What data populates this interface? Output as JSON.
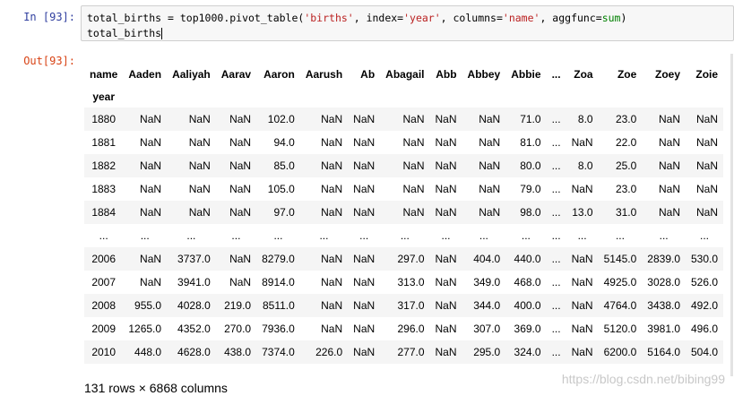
{
  "prompts": {
    "in": "In  [93]:",
    "out": "Out[93]:"
  },
  "code": {
    "line1_parts": [
      "total_births = top1000.pivot_table(",
      "'births'",
      ", index=",
      "'year'",
      ", columns=",
      "'name'",
      ", aggfunc=",
      "sum",
      ")"
    ],
    "line2": "total_births"
  },
  "table": {
    "column_header_label": "name",
    "columns": [
      "Aaden",
      "Aaliyah",
      "Aarav",
      "Aaron",
      "Aarush",
      "Ab",
      "Abagail",
      "Abb",
      "Abbey",
      "Abbie",
      "...",
      "Zoa",
      "Zoe",
      "Zoey",
      "Zoie"
    ],
    "index_label": "year",
    "rows": [
      {
        "year": "1880",
        "values": [
          "NaN",
          "NaN",
          "NaN",
          "102.0",
          "NaN",
          "NaN",
          "NaN",
          "NaN",
          "NaN",
          "71.0",
          "...",
          "8.0",
          "23.0",
          "NaN",
          "NaN"
        ]
      },
      {
        "year": "1881",
        "values": [
          "NaN",
          "NaN",
          "NaN",
          "94.0",
          "NaN",
          "NaN",
          "NaN",
          "NaN",
          "NaN",
          "81.0",
          "...",
          "NaN",
          "22.0",
          "NaN",
          "NaN"
        ]
      },
      {
        "year": "1882",
        "values": [
          "NaN",
          "NaN",
          "NaN",
          "85.0",
          "NaN",
          "NaN",
          "NaN",
          "NaN",
          "NaN",
          "80.0",
          "...",
          "8.0",
          "25.0",
          "NaN",
          "NaN"
        ]
      },
      {
        "year": "1883",
        "values": [
          "NaN",
          "NaN",
          "NaN",
          "105.0",
          "NaN",
          "NaN",
          "NaN",
          "NaN",
          "NaN",
          "79.0",
          "...",
          "NaN",
          "23.0",
          "NaN",
          "NaN"
        ]
      },
      {
        "year": "1884",
        "values": [
          "NaN",
          "NaN",
          "NaN",
          "97.0",
          "NaN",
          "NaN",
          "NaN",
          "NaN",
          "NaN",
          "98.0",
          "...",
          "13.0",
          "31.0",
          "NaN",
          "NaN"
        ]
      },
      {
        "year": "...",
        "values": [
          "...",
          "...",
          "...",
          "...",
          "...",
          "...",
          "...",
          "...",
          "...",
          "...",
          "...",
          "...",
          "...",
          "...",
          "..."
        ]
      },
      {
        "year": "2006",
        "values": [
          "NaN",
          "3737.0",
          "NaN",
          "8279.0",
          "NaN",
          "NaN",
          "297.0",
          "NaN",
          "404.0",
          "440.0",
          "...",
          "NaN",
          "5145.0",
          "2839.0",
          "530.0"
        ]
      },
      {
        "year": "2007",
        "values": [
          "NaN",
          "3941.0",
          "NaN",
          "8914.0",
          "NaN",
          "NaN",
          "313.0",
          "NaN",
          "349.0",
          "468.0",
          "...",
          "NaN",
          "4925.0",
          "3028.0",
          "526.0"
        ]
      },
      {
        "year": "2008",
        "values": [
          "955.0",
          "4028.0",
          "219.0",
          "8511.0",
          "NaN",
          "NaN",
          "317.0",
          "NaN",
          "344.0",
          "400.0",
          "...",
          "NaN",
          "4764.0",
          "3438.0",
          "492.0"
        ]
      },
      {
        "year": "2009",
        "values": [
          "1265.0",
          "4352.0",
          "270.0",
          "7936.0",
          "NaN",
          "NaN",
          "296.0",
          "NaN",
          "307.0",
          "369.0",
          "...",
          "NaN",
          "5120.0",
          "3981.0",
          "496.0"
        ]
      },
      {
        "year": "2010",
        "values": [
          "448.0",
          "4628.0",
          "438.0",
          "7374.0",
          "226.0",
          "NaN",
          "277.0",
          "NaN",
          "295.0",
          "324.0",
          "...",
          "NaN",
          "6200.0",
          "5164.0",
          "504.0"
        ]
      }
    ]
  },
  "shape_text": "131 rows × 6868 columns",
  "watermark": "https://blog.csdn.net/bibing99"
}
